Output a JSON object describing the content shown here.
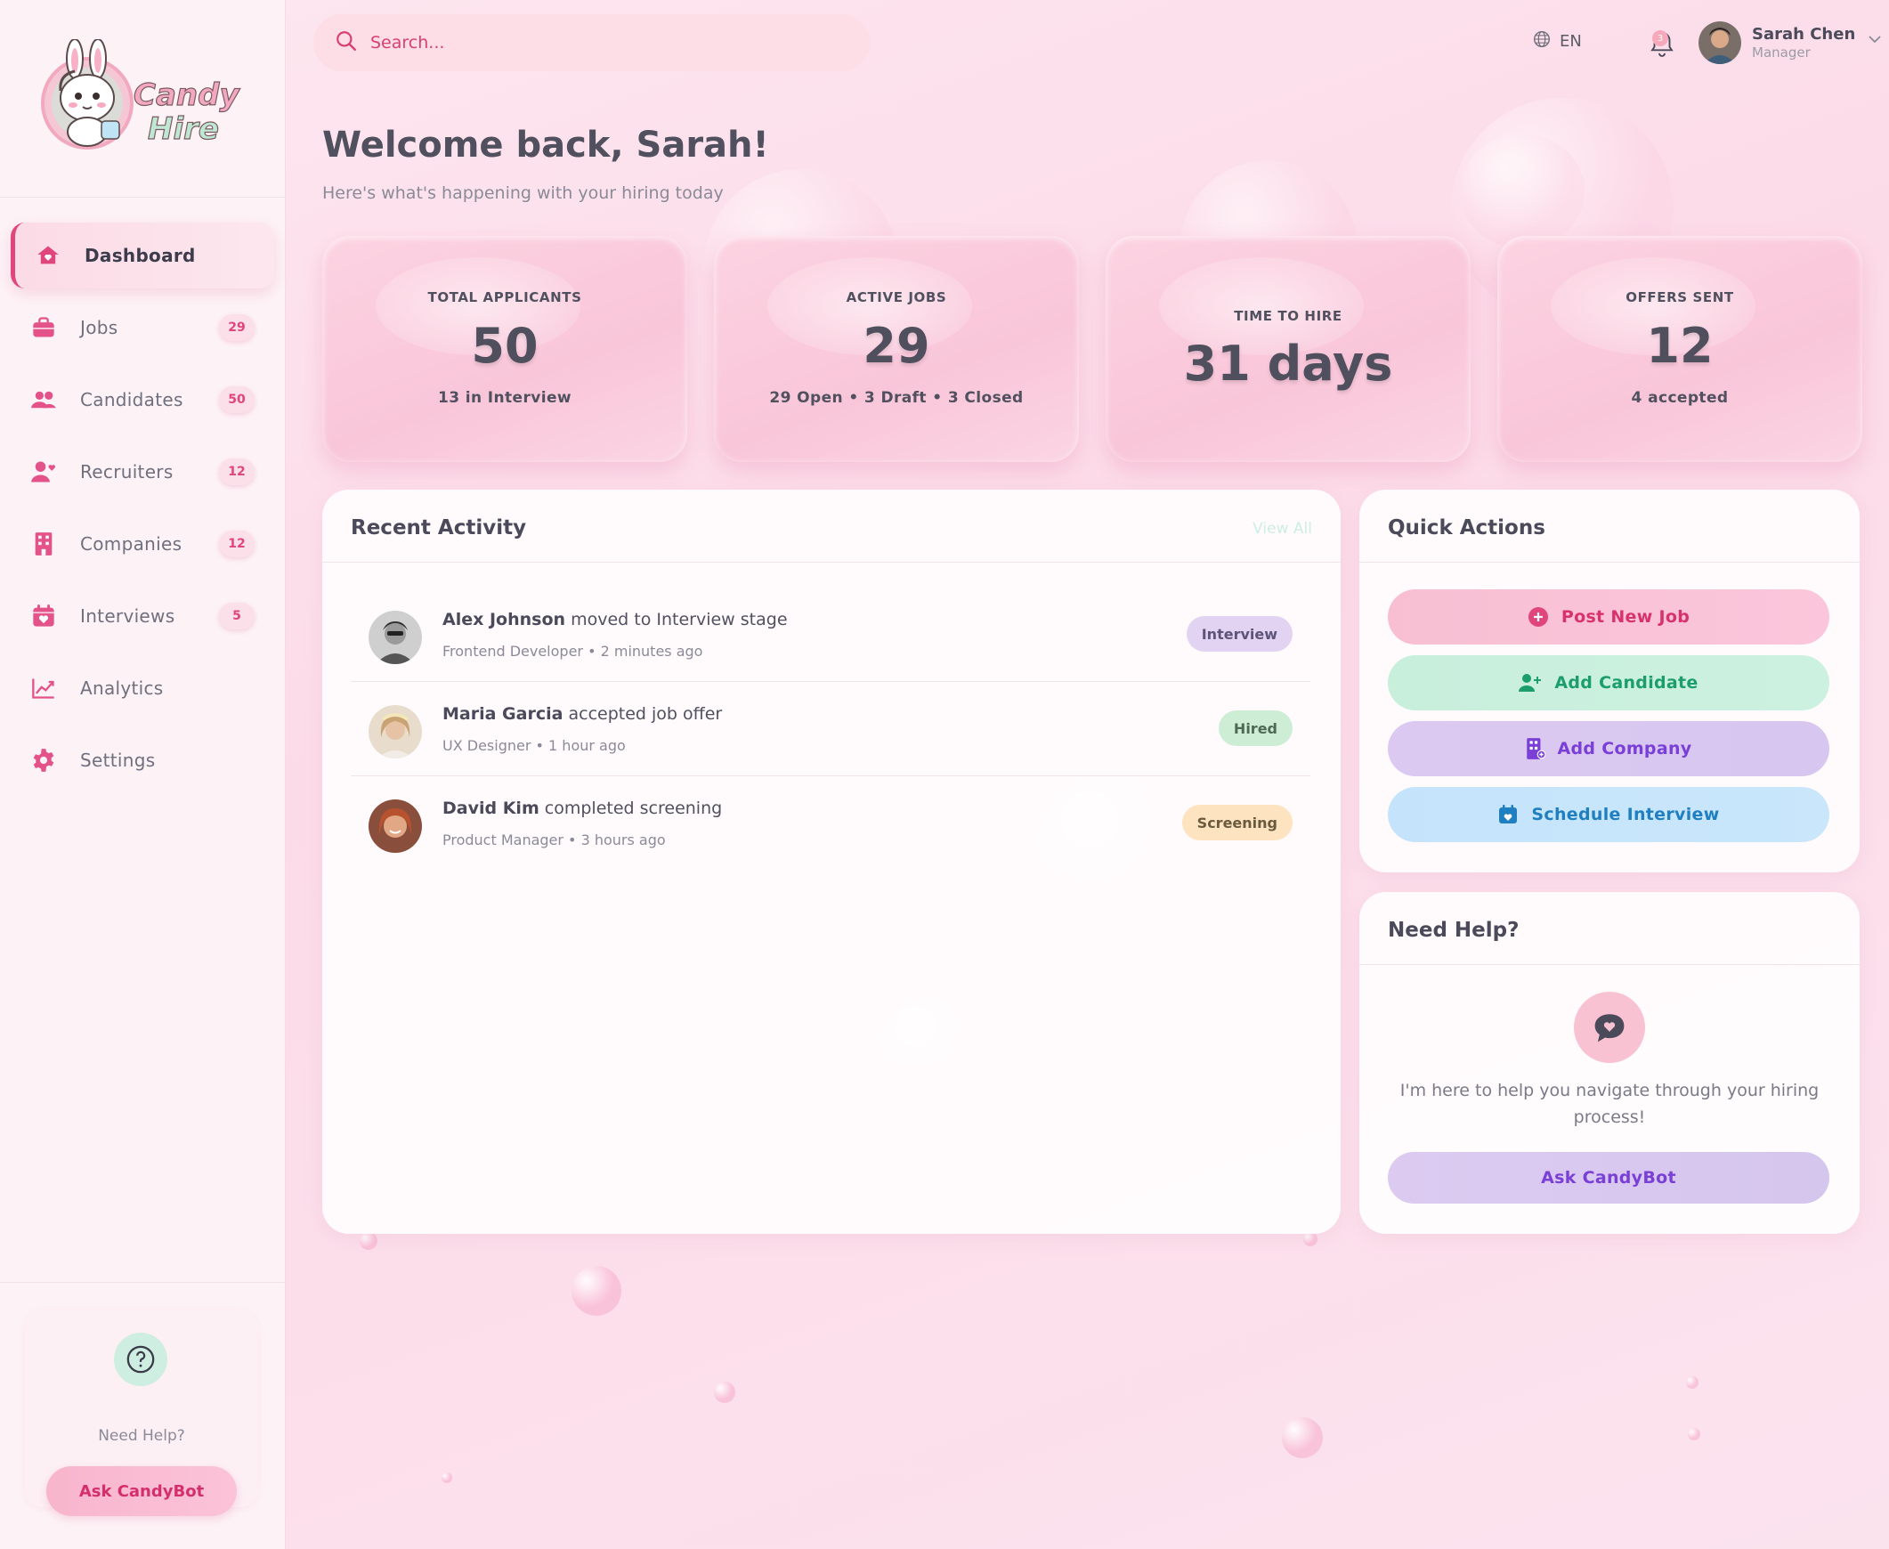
{
  "brand": {
    "name_line1": "Candy",
    "name_line2": "Hire"
  },
  "colors": {
    "accent": "#e0457b",
    "mint": "#1c9e6c",
    "lavender": "#7a3fd6",
    "sky": "#1f7fc1"
  },
  "sidebar": {
    "items": [
      {
        "label": "Dashboard",
        "icon": "home-icon",
        "badge": ""
      },
      {
        "label": "Jobs",
        "icon": "briefcase-icon",
        "badge": "29"
      },
      {
        "label": "Candidates",
        "icon": "users-icon",
        "badge": "50"
      },
      {
        "label": "Recruiters",
        "icon": "user-heart-icon",
        "badge": "12"
      },
      {
        "label": "Companies",
        "icon": "building-icon",
        "badge": "12"
      },
      {
        "label": "Interviews",
        "icon": "calendar-heart-icon",
        "badge": "5"
      },
      {
        "label": "Analytics",
        "icon": "chart-line-icon",
        "badge": ""
      },
      {
        "label": "Settings",
        "icon": "gear-icon",
        "badge": ""
      }
    ],
    "help": {
      "text": "Need Help?",
      "button": "Ask CandyBot"
    }
  },
  "header": {
    "search_placeholder": "Search...",
    "language": "EN",
    "notification_count": "3",
    "user": {
      "name": "Sarah Chen",
      "role": "Manager"
    }
  },
  "welcome": {
    "title": "Welcome back, Sarah!",
    "subtitle": "Here's what's happening with your hiring today"
  },
  "stats": [
    {
      "label": "TOTAL APPLICANTS",
      "value": "50",
      "detail": "13 in Interview"
    },
    {
      "label": "ACTIVE JOBS",
      "value": "29",
      "detail": "29 Open • 3 Draft • 3 Closed"
    },
    {
      "label": "TIME TO HIRE",
      "value": "31 days",
      "detail": ""
    },
    {
      "label": "OFFERS SENT",
      "value": "12",
      "detail": "4 accepted"
    }
  ],
  "activity": {
    "title": "Recent Activity",
    "view_all": "View All",
    "items": [
      {
        "name": "Alex Johnson",
        "action": "moved to Interview stage",
        "meta": "Frontend Developer • 2 minutes ago",
        "tag": "Interview"
      },
      {
        "name": "Maria Garcia",
        "action": "accepted job offer",
        "meta": "UX Designer • 1 hour ago",
        "tag": "Hired"
      },
      {
        "name": "David Kim",
        "action": "completed screening",
        "meta": "Product Manager • 3 hours ago",
        "tag": "Screening"
      }
    ]
  },
  "quick_actions": {
    "title": "Quick Actions",
    "buttons": [
      "Post New Job",
      "Add Candidate",
      "Add Company",
      "Schedule Interview"
    ]
  },
  "help_panel": {
    "title": "Need Help?",
    "text": "I'm here to help you navigate through your hiring process!",
    "button": "Ask CandyBot"
  }
}
